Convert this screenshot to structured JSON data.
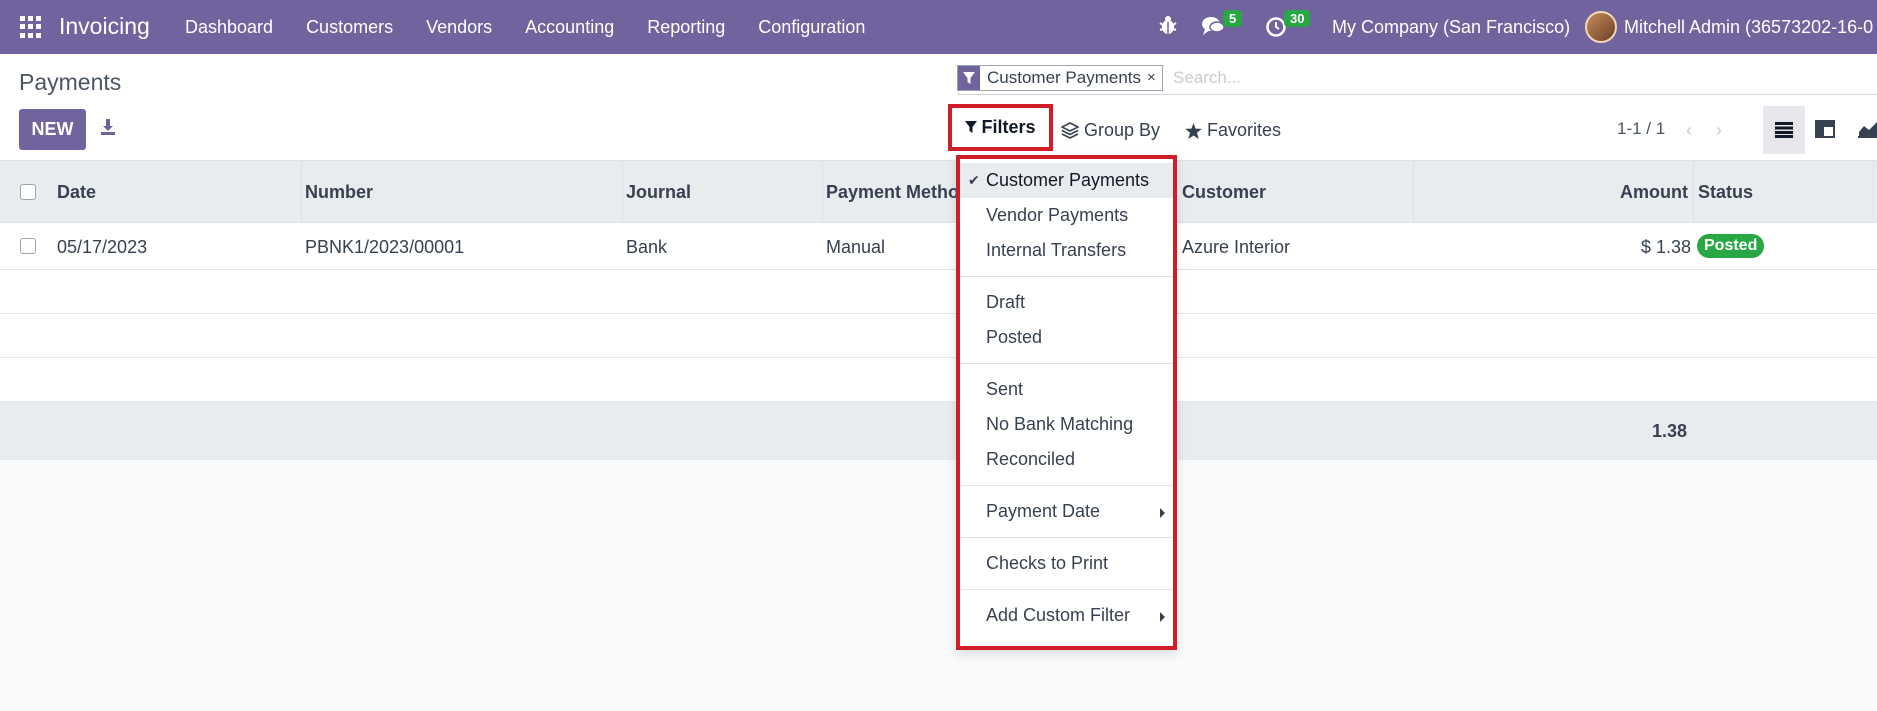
{
  "navbar": {
    "apps_icon": "grid-icon",
    "brand": "Invoicing",
    "menu": [
      "Dashboard",
      "Customers",
      "Vendors",
      "Accounting",
      "Reporting",
      "Configuration"
    ],
    "debug_icon": "bug-icon",
    "messages_icon": "chat-icon",
    "messages_count": "5",
    "activities_icon": "clock-icon",
    "activities_count": "30",
    "company": "My Company (San Francisco)",
    "user": "Mitchell Admin (36573202-16-0"
  },
  "control_panel": {
    "breadcrumb": "Payments",
    "new_label": "NEW",
    "search": {
      "facet_label": "Customer Payments",
      "facet_remove": "×",
      "placeholder": "Search..."
    },
    "filters_label": "Filters",
    "groupby_label": "Group By",
    "favorites_label": "Favorites",
    "pager": "1-1 / 1",
    "pager_prev": "‹",
    "pager_next": "›"
  },
  "table": {
    "headers": {
      "date": "Date",
      "number": "Number",
      "journal": "Journal",
      "payment_method": "Payment Metho",
      "customer": "Customer",
      "amount": "Amount",
      "status": "Status"
    },
    "rows": [
      {
        "date": "05/17/2023",
        "number": "PBNK1/2023/00001",
        "journal": "Bank",
        "payment_method": "Manual",
        "customer": "Azure Interior",
        "amount": "$ 1.38",
        "status": "Posted"
      }
    ],
    "total": "1.38"
  },
  "filters_dropdown": {
    "selected_check": "✔",
    "group1": [
      "Customer Payments",
      "Vendor Payments",
      "Internal Transfers"
    ],
    "group2": [
      "Draft",
      "Posted"
    ],
    "group3": [
      "Sent",
      "No Bank Matching",
      "Reconciled"
    ],
    "payment_date": "Payment Date",
    "checks_to_print": "Checks to Print",
    "add_custom_filter": "Add Custom Filter"
  },
  "colors": {
    "brand": "#71639e",
    "highlight": "#d01d2a",
    "success": "#28a745"
  }
}
